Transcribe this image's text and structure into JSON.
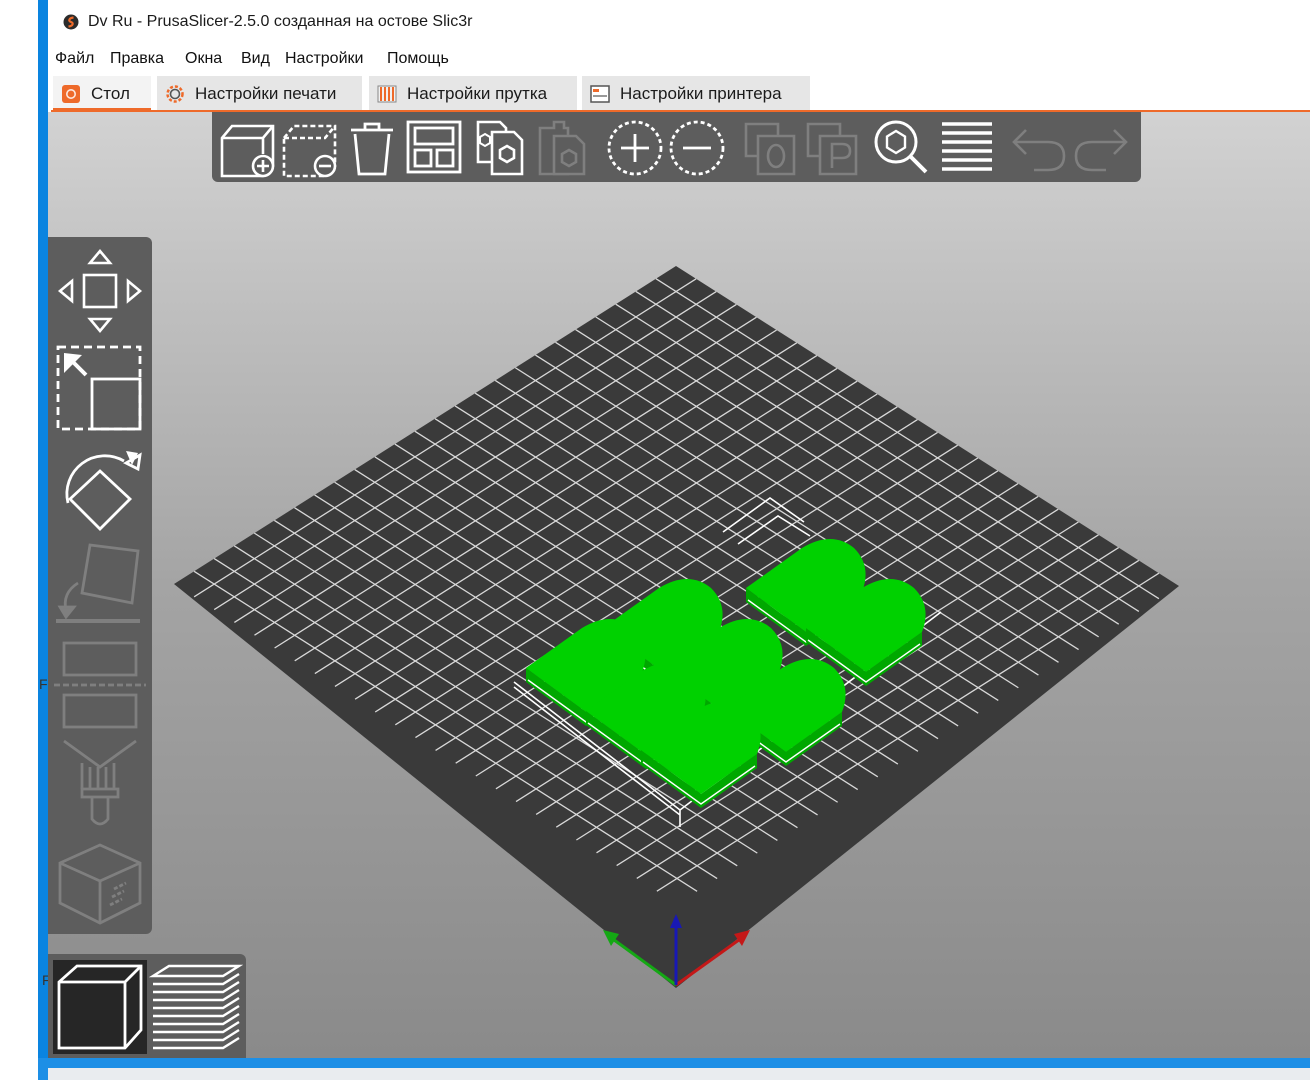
{
  "window": {
    "title": "Dv Ru - PrusaSlicer-2.5.0 созданная на остове Slic3r",
    "app_icon": "prusaslicer-logo-icon"
  },
  "menu": {
    "items": [
      "Файл",
      "Правка",
      "Окна",
      "Вид",
      "Настройки",
      "Помощь"
    ]
  },
  "tabs": [
    {
      "label": "Стол",
      "icon": "plater-icon",
      "active": true
    },
    {
      "label": "Настройки печати",
      "icon": "print-settings-cog-icon",
      "active": false
    },
    {
      "label": "Настройки прутка",
      "icon": "filament-spool-icon",
      "active": false
    },
    {
      "label": "Настройки принтера",
      "icon": "printer-icon",
      "active": false
    }
  ],
  "top_toolbar": [
    {
      "name": "add-object",
      "icon": "add-cube-icon",
      "enabled": true
    },
    {
      "name": "delete",
      "icon": "delete-dashed-cube-icon",
      "enabled": true
    },
    {
      "name": "delete-all",
      "icon": "trash-icon",
      "enabled": true
    },
    {
      "name": "arrange",
      "icon": "arrange-icon",
      "enabled": true
    },
    {
      "name": "copy",
      "icon": "copy-icon",
      "enabled": true
    },
    {
      "name": "paste",
      "icon": "paste-icon",
      "enabled": false
    },
    {
      "name": "add-instance",
      "icon": "plus-circle-icon",
      "enabled": true
    },
    {
      "name": "remove-instance",
      "icon": "minus-circle-icon",
      "enabled": true
    },
    {
      "name": "split-to-objects",
      "icon": "split-objects-icon",
      "enabled": false
    },
    {
      "name": "split-to-parts",
      "icon": "split-parts-icon",
      "enabled": false
    },
    {
      "name": "search",
      "icon": "search-icon",
      "enabled": true
    },
    {
      "name": "layers-editing",
      "icon": "layers-icon",
      "enabled": true
    },
    {
      "name": "undo",
      "icon": "undo-icon",
      "enabled": false
    },
    {
      "name": "redo",
      "icon": "redo-icon",
      "enabled": false
    }
  ],
  "left_toolbar": [
    {
      "name": "move",
      "icon": "move-arrows-icon",
      "enabled": true
    },
    {
      "name": "scale",
      "icon": "scale-icon",
      "enabled": true
    },
    {
      "name": "rotate",
      "icon": "rotate-icon",
      "enabled": true
    },
    {
      "name": "place-on-face",
      "icon": "place-on-face-icon",
      "enabled": false
    },
    {
      "name": "cut",
      "icon": "cut-icon",
      "enabled": false
    },
    {
      "name": "paint-supports",
      "icon": "paint-supports-icon",
      "enabled": false
    },
    {
      "name": "seam-painting",
      "icon": "seam-painting-icon",
      "enabled": false
    }
  ],
  "view_toolbar": [
    {
      "name": "3d-view",
      "icon": "3d-cube-view-icon",
      "active": true
    },
    {
      "name": "preview",
      "icon": "layers-preview-icon",
      "active": false
    }
  ],
  "scene": {
    "bed_color": "#3a3a3a",
    "grid_color": "#d8d8d8",
    "object_color": "#00d100",
    "object_count": 8,
    "axes": [
      "x",
      "y",
      "z"
    ]
  },
  "colors": {
    "accent": "#ee6a2a",
    "toolbar_bg": "#5d5d5d",
    "window_border": "#0a84e0"
  }
}
